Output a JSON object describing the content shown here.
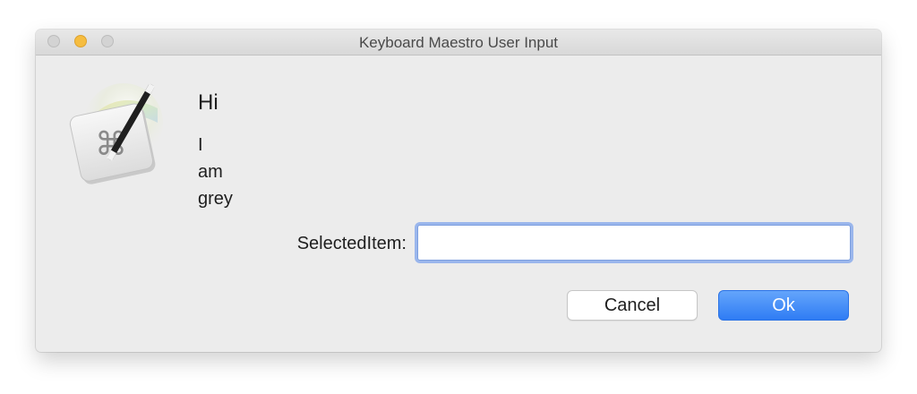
{
  "window": {
    "title": "Keyboard Maestro User Input"
  },
  "dialog": {
    "heading": "Hi",
    "message_lines": [
      "I",
      "am",
      "grey"
    ],
    "field": {
      "label": "SelectedItem:",
      "value": "",
      "placeholder": ""
    },
    "buttons": {
      "cancel_label": "Cancel",
      "ok_label": "Ok"
    }
  },
  "icons": {
    "app": "keyboard-maestro-app-icon",
    "glyph": "⌘"
  },
  "colors": {
    "accent": "#2f7cf4",
    "focus_ring": "#9ab6ec",
    "window_bg": "#ececec",
    "minimize": "#f6bd40"
  }
}
